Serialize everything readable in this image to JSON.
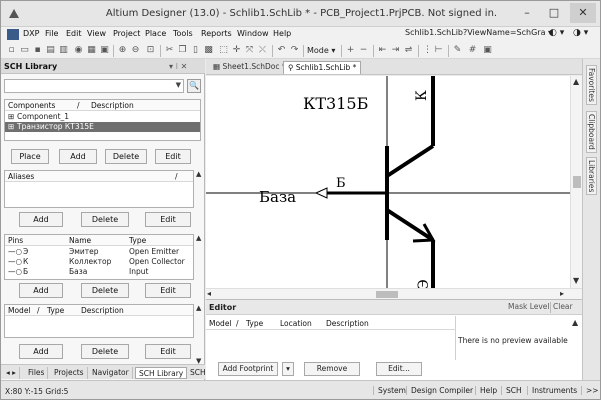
{
  "window": {
    "title": "Altium Designer (13.0) - Schlib1.SchLib * - PCB_Project1.PrjPCB. Not signed in.",
    "minimize": "–",
    "maximize": "□",
    "close": "✕"
  },
  "menubar": {
    "items": [
      "DXP",
      "File",
      "Edit",
      "View",
      "Project",
      "Place",
      "Tools",
      "Reports",
      "Window",
      "Help"
    ],
    "path_field": "Schlib1.SchLib?ViewName=SchGra ▾"
  },
  "toolbar": {
    "mode_label": "Mode ▾"
  },
  "left_panel": {
    "title": "SCH Library",
    "controls": "▾ ⁝ ✕",
    "filter_value": "",
    "components": {
      "headers": [
        "Components",
        "Description"
      ],
      "rows": [
        "Component_1",
        "Транзистор КТ315Е"
      ],
      "selected_index": 1
    },
    "component_buttons": [
      "Place",
      "Add",
      "Delete",
      "Edit"
    ],
    "aliases_header": "Aliases",
    "alias_buttons": [
      "Add",
      "Delete",
      "Edit"
    ],
    "pins": {
      "headers": [
        "Pins",
        "Name",
        "Type"
      ],
      "rows": [
        {
          "pin": "Э",
          "name": "Эмитер",
          "type": "Open Emitter"
        },
        {
          "pin": "К",
          "name": "Коллектор",
          "type": "Open Collector"
        },
        {
          "pin": "Б",
          "name": "База",
          "type": "Input"
        }
      ]
    },
    "pin_buttons": [
      "Add",
      "Delete",
      "Edit"
    ],
    "model": {
      "headers": [
        "Model",
        "Type",
        "Description"
      ]
    },
    "model_buttons": [
      "Add",
      "Delete",
      "Edit"
    ],
    "bottom_tabs": [
      "Files",
      "Projects",
      "Navigator",
      "SCH Library",
      "SCH"
    ],
    "active_bottom_tab": "SCH Library"
  },
  "document_tabs": [
    {
      "label": "Sheet1.SchDoc *",
      "active": false
    },
    {
      "label": "Schlib1.SchLib *",
      "active": true
    }
  ],
  "schematic": {
    "part_name": "КТ315Б",
    "base_label": "База",
    "pin_base": "Б",
    "pin_collector": "К",
    "pin_emitter": "Э"
  },
  "editor": {
    "title": "Editor",
    "mask_level": "Mask Level",
    "clear": "Clear",
    "grid_headers": [
      "Model",
      "Type",
      "Location",
      "Description"
    ],
    "preview_text": "There is no preview available",
    "buttons": [
      "Add Footprint",
      "Remove",
      "Edit..."
    ]
  },
  "side_tabs": [
    "Favorites",
    "Clipboard",
    "Libraries"
  ],
  "statusbar": {
    "coords": "X:80 Y:-15   Grid:5",
    "items": [
      "System",
      "Design Compiler",
      "Help",
      "SCH",
      "Instruments",
      ">>"
    ]
  },
  "colors": {
    "selection": "#6f6f6f",
    "canvas": "#ffffff",
    "schematic_line": "#000000"
  }
}
